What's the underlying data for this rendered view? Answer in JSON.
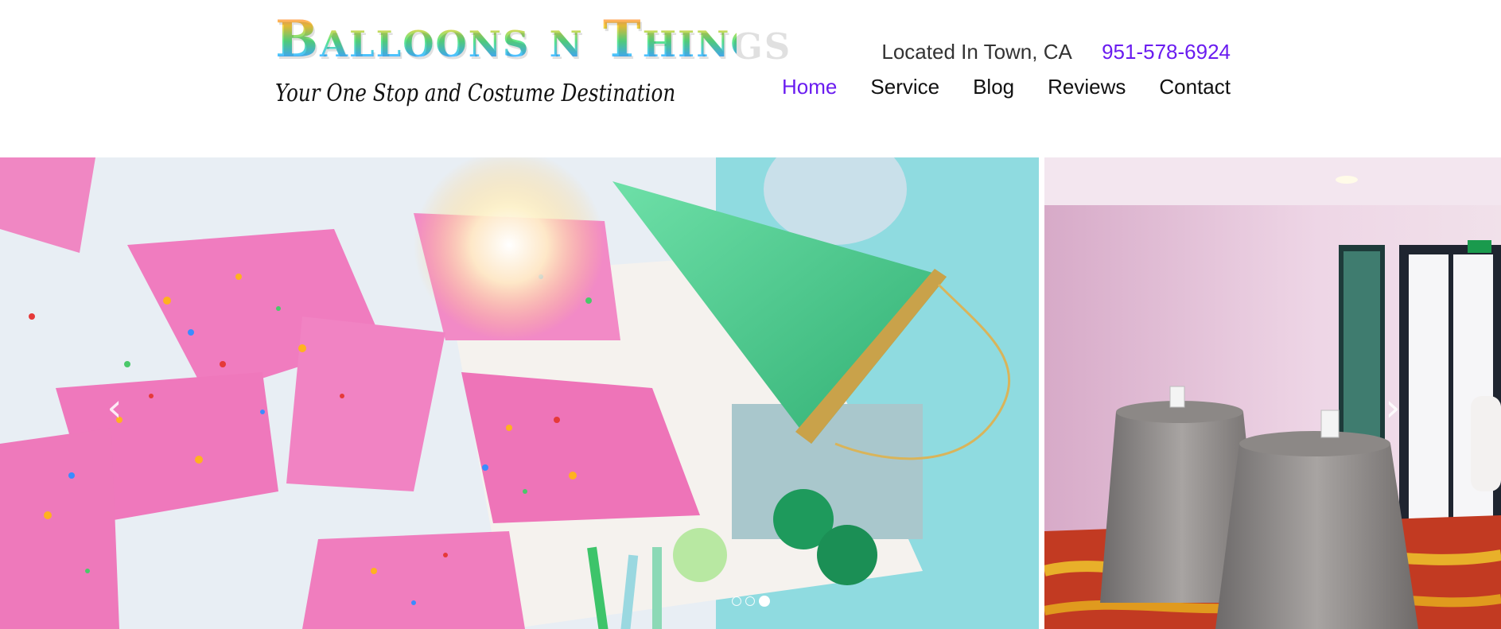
{
  "header": {
    "logo_text": "Balloons n Things",
    "tagline": "Your One Stop and Costume Destination",
    "location": "Located In Town, CA",
    "phone": "951-578-6924"
  },
  "nav": {
    "items": [
      {
        "label": "Home",
        "active": true
      },
      {
        "label": "Service",
        "active": false
      },
      {
        "label": "Blog",
        "active": false
      },
      {
        "label": "Reviews",
        "active": false
      },
      {
        "label": "Contact",
        "active": false
      }
    ]
  },
  "slider": {
    "prev_icon": "chevron-left-icon",
    "next_icon": "chevron-right-icon",
    "prev_glyph": "‹",
    "next_glyph": "›",
    "slide_count": 3,
    "active_slide": 3
  },
  "colors": {
    "accent": "#6a1cf0",
    "text": "#111111"
  }
}
